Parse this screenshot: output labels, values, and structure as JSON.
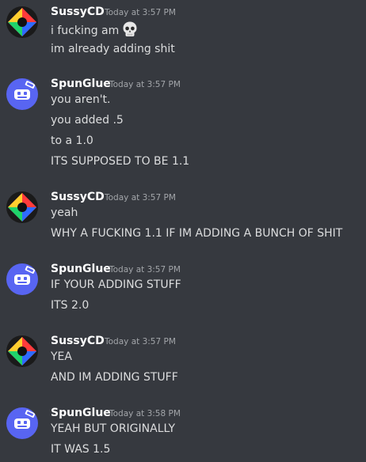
{
  "messages": [
    {
      "author": "SussyCD",
      "avatar": "sussycd-avatar",
      "timestamp": "Today at 3:57 PM",
      "lines": [
        "i fucking am",
        "im already adding shit"
      ]
    },
    {
      "author": "SpunGlue",
      "avatar": "spunglue-avatar",
      "timestamp": "Today at 3:57 PM",
      "lines": [
        "you aren't.",
        "you added .5",
        "to a 1.0",
        "ITS SUPPOSED TO BE 1.1"
      ]
    },
    {
      "author": "SussyCD",
      "avatar": "sussycd-avatar",
      "timestamp": "Today at 3:57 PM",
      "lines": [
        "yeah",
        "WHY A FUCKING 1.1 IF IM ADDING A BUNCH OF SHIT"
      ]
    },
    {
      "author": "SpunGlue",
      "avatar": "spunglue-avatar",
      "timestamp": "Today at 3:57 PM",
      "lines": [
        "IF YOUR ADDING STUFF",
        "ITS 2.0"
      ]
    },
    {
      "author": "SussyCD",
      "avatar": "sussycd-avatar",
      "timestamp": "Today at 3:57 PM",
      "lines": [
        "YEA",
        "AND IM ADDING STUFF"
      ]
    },
    {
      "author": "SpunGlue",
      "avatar": "spunglue-avatar",
      "timestamp": "Today at 3:58 PM",
      "lines": [
        "YEAH BUT ORIGINALLY",
        "IT WAS 1.5"
      ]
    }
  ],
  "emoji": {
    "name": "skull-emoji",
    "message": 0,
    "line": 0
  },
  "colors": {
    "background": "#36393f",
    "username": "#ffffff",
    "message_text": "#dcddde",
    "timestamp": "#a3a6aa",
    "spunglue_avatar": "#5865f2"
  }
}
